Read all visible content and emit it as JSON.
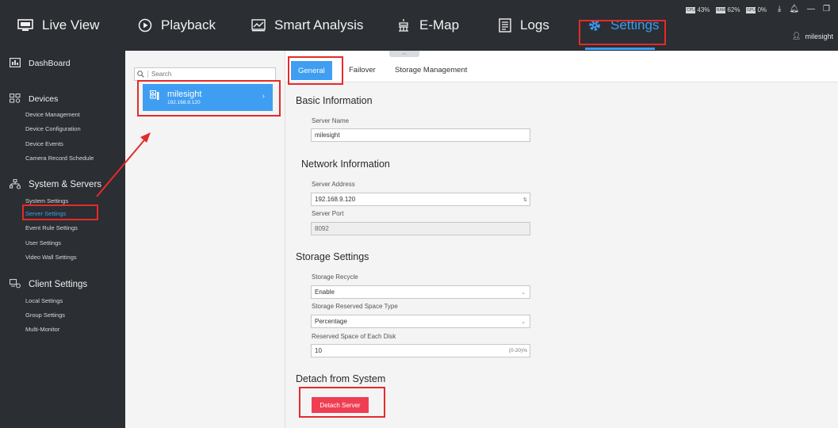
{
  "topnav": {
    "items": [
      {
        "label": "Live View"
      },
      {
        "label": "Playback"
      },
      {
        "label": "Smart Analysis"
      },
      {
        "label": "E-Map"
      },
      {
        "label": "Logs"
      },
      {
        "label": "Settings"
      }
    ],
    "active_index": 5,
    "accent_color": "#3d9cf0",
    "highlight_color": "#e52a2a"
  },
  "system_stats": {
    "cpu": {
      "label": "CPU",
      "value": "43%"
    },
    "ram": {
      "label": "RAM",
      "value": "62%"
    },
    "gpu": {
      "label": "GPU",
      "value": "0%"
    }
  },
  "user": {
    "name": "milesight"
  },
  "sidebar": {
    "dashboard": "DashBoard",
    "devices": {
      "title": "Devices",
      "items": [
        "Device Management",
        "Device Configuration",
        "Device Events",
        "Camera Record Schedule"
      ]
    },
    "system": {
      "title": "System & Servers",
      "items": [
        "System Settings",
        "Server Settings",
        "Event Rule Settings",
        "User Settings",
        "Video Wall Settings"
      ],
      "active_index": 1
    },
    "client": {
      "title": "Client Settings",
      "items": [
        "Local Settings",
        "Group Settings",
        "Multi-Monitor"
      ]
    }
  },
  "server_list": {
    "search_placeholder": "Search",
    "servers": [
      {
        "name": "milesight",
        "ip": "192.168.9.120"
      }
    ]
  },
  "tabs": {
    "items": [
      "General",
      "Failover",
      "Storage Management"
    ],
    "active_index": 0
  },
  "general": {
    "basic": {
      "title": "Basic Information",
      "server_name_label": "Server Name",
      "server_name_value": "milesight"
    },
    "network": {
      "title": "Network Information",
      "server_address_label": "Server Address",
      "server_address_value": "192.168.9.120",
      "server_port_label": "Server Port",
      "server_port_value": "8092"
    },
    "storage": {
      "title": "Storage Settings",
      "recycle_label": "Storage Recycle",
      "recycle_value": "Enable",
      "reserved_type_label": "Storage Reserved Space Type",
      "reserved_type_value": "Percentage",
      "reserved_space_label": "Reserved Space of Each Disk",
      "reserved_space_value": "10",
      "reserved_space_range": "(0-20)%"
    },
    "detach": {
      "title": "Detach from System",
      "button_label": "Detach Server",
      "button_color": "#ef3e53"
    }
  }
}
